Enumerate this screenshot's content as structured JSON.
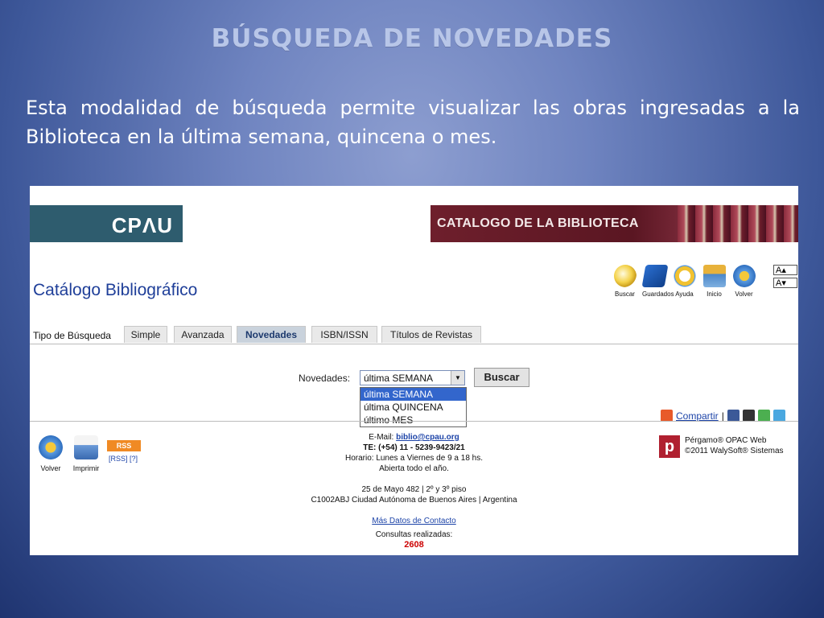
{
  "slide": {
    "title": "BÚSQUEDA DE NOVEDADES",
    "body": "Esta modalidad  de búsqueda permite visualizar las obras ingresadas a la Biblioteca en la última semana, quincena o mes."
  },
  "header": {
    "logo": "CPΛU",
    "banner": "CATALOGO DE LA BIBLIOTECA"
  },
  "page_title": "Catálogo Bibliográfico",
  "toolbar": {
    "items": [
      "Buscar",
      "Guardados",
      "Ayuda",
      "Inicio",
      "Volver"
    ],
    "font_up": "A",
    "font_down": "A"
  },
  "tabs": {
    "label": "Tipo de Búsqueda",
    "items": [
      "Simple",
      "Avanzada",
      "Novedades",
      "ISBN/ISSN",
      "Títulos de Revistas"
    ],
    "active": "Novedades"
  },
  "search": {
    "label": "Novedades:",
    "selected": "última SEMANA",
    "options": [
      "última SEMANA",
      "última QUINCENA",
      "último MES"
    ],
    "button": "Buscar"
  },
  "share": {
    "label": "Compartir",
    "sep": "|"
  },
  "footer": {
    "icons": [
      "Volver",
      "Imprimir"
    ],
    "rss_badge": "RSS",
    "rss_links": "[RSS] [?]",
    "email_label": "E-Mail:",
    "email": "biblio@cpau.org",
    "phone": "TE: (+54) 11 - 5239-9423/21",
    "hours": "Horario: Lunes a Viernes de 9 a 18 hs.",
    "open": "Abierta todo el año.",
    "address1": "25 de Mayo 482 | 2º y 3º piso",
    "address2": "C1002ABJ Ciudad Autónoma de Buenos Aires | Argentina",
    "more": "Más Datos de Contacto",
    "queries_label": "Consultas realizadas:",
    "queries": "2608",
    "pergamo1": "Pérgamo® OPAC Web",
    "pergamo2": "©2011 WalySoft® Sistemas"
  }
}
